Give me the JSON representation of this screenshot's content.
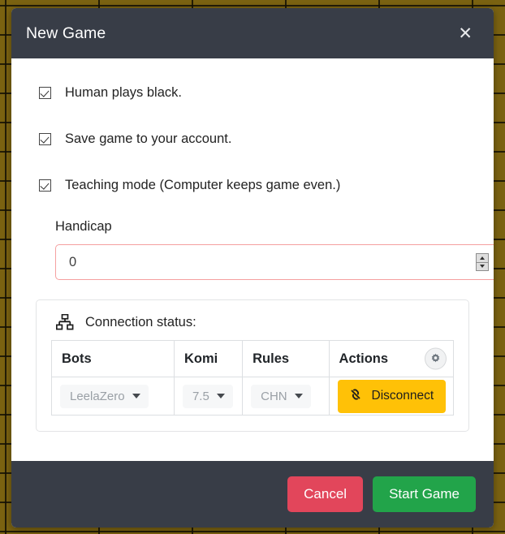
{
  "background": {
    "name": "go-board",
    "board_color": "#7a6211",
    "line_color": "#141004"
  },
  "modal": {
    "title": "New Game",
    "close_label": "✕",
    "header_color": "#383d47",
    "options": [
      {
        "label": "Human plays black.",
        "checked": true
      },
      {
        "label": "Save game to your account.",
        "checked": true
      },
      {
        "label": "Teaching mode (Computer keeps game even.)",
        "checked": true
      }
    ],
    "handicap": {
      "label": "Handicap",
      "value": "0",
      "placeholder": "0",
      "invalid": true,
      "border_color": "#f5a0a0"
    },
    "connection": {
      "icon": "sitemap-icon",
      "label": "Connection status:",
      "settings_icon": "gear-icon",
      "columns": [
        "Bots",
        "Komi",
        "Rules",
        "Actions"
      ],
      "row": {
        "bot": "LeelaZero",
        "komi": "7.5",
        "rules": "CHN",
        "action_label": "Disconnect",
        "action_icon": "unlink-icon",
        "action_color": "#ffc107"
      }
    },
    "footer": {
      "cancel_label": "Cancel",
      "cancel_color": "#e2465b",
      "start_label": "Start Game",
      "start_color": "#22a44a"
    }
  }
}
